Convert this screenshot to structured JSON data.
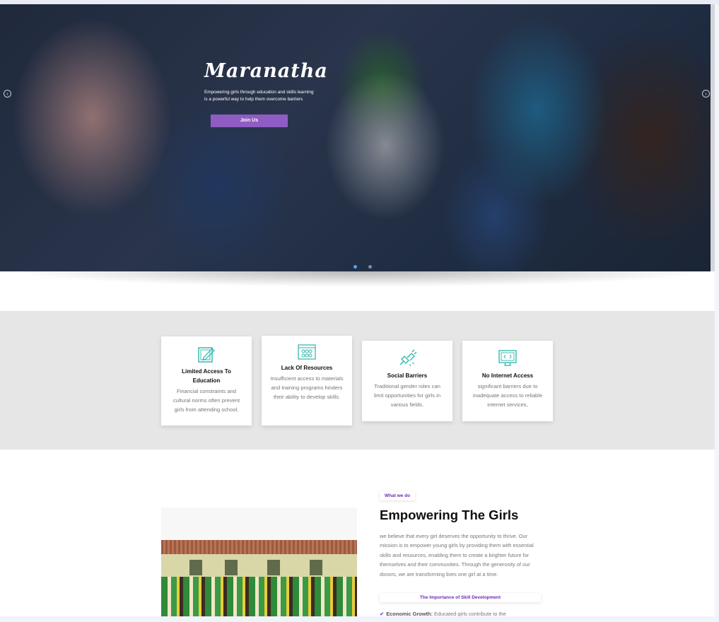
{
  "hero": {
    "title": "Maranatha",
    "subtitle": "Empowering girls through education and skills learning is a powerful way to help them overcome barriers",
    "cta_label": "Join Us",
    "prev_icon": "arrow-left-circle-icon",
    "next_icon": "arrow-right-circle-icon",
    "slides": 2,
    "active_slide": 1
  },
  "features": [
    {
      "icon": "edit-certificate-icon",
      "title": "Limited Access To Education",
      "text": "Financial constraints and cultural norms often prevent girls from attending school."
    },
    {
      "icon": "resource-grid-icon",
      "title": "Lack Of Resources",
      "text": "Insufficient access to materials and training programs hinders their ability to develop skills."
    },
    {
      "icon": "broken-plug-icon",
      "title": "Social Barriers",
      "text": "Traditional gender roles can limit opportunities for girls in various fields."
    },
    {
      "icon": "monitor-code-icon",
      "title": "No Internet Access",
      "text": "significant barriers due to inadequate access to reliable internet services,"
    }
  ],
  "about": {
    "tag": "What we do",
    "title": "Empowering The Girls",
    "text": "we believe that every girl deserves the opportunity to thrive. Our mission is to empower young girls by providing them with essential skills and resources, enabling them to create a brighter future for themselves and their communities. Through the generosity of our donors, we are transforming lives one girl at a time.",
    "subheading": "The Importance of Skill Development",
    "bullet_label": "Economic Growth:",
    "bullet_text": " Educated girls contribute to the"
  },
  "colors": {
    "accent": "#8e5cc2",
    "accent_text": "#6a2bb3",
    "icon_teal": "#2bb5a8",
    "band_bg": "#e6e6e6"
  }
}
